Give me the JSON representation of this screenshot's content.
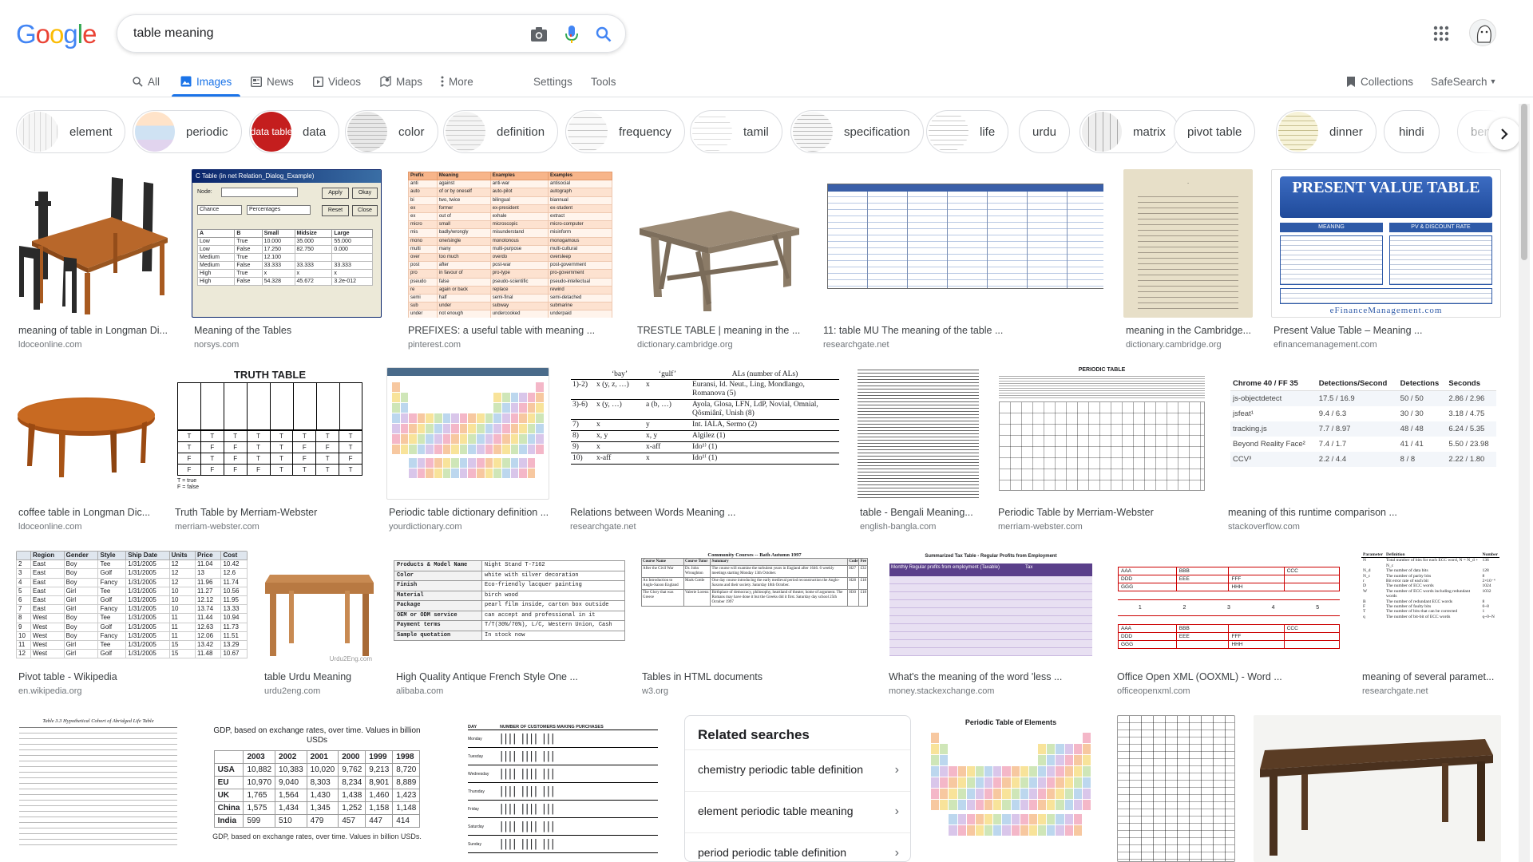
{
  "logo": "Google",
  "search": {
    "query": "table meaning"
  },
  "tabs": [
    {
      "label": "All"
    },
    {
      "label": "Images"
    },
    {
      "label": "News"
    },
    {
      "label": "Videos"
    },
    {
      "label": "Maps"
    },
    {
      "label": "More"
    },
    {
      "label": "Settings"
    },
    {
      "label": "Tools"
    }
  ],
  "topright": {
    "collections": "Collections",
    "safesearch": "SafeSearch"
  },
  "chips": [
    {
      "label": "element"
    },
    {
      "label": "periodic"
    },
    {
      "label": "data",
      "thumb_text": "data table"
    },
    {
      "label": "color"
    },
    {
      "label": "definition"
    },
    {
      "label": "frequency"
    },
    {
      "label": "tamil"
    },
    {
      "label": "specification"
    },
    {
      "label": "life"
    },
    {
      "label": "urdu"
    },
    {
      "label": "matrix"
    },
    {
      "label": "pivot table"
    },
    {
      "label": "dinner"
    },
    {
      "label": "hindi"
    },
    {
      "label": "beng"
    }
  ],
  "results": [
    {
      "title": "meaning of table in Longman Di...",
      "source": "ldoceonline.com"
    },
    {
      "title": "Meaning of the Tables",
      "source": "norsys.com"
    },
    {
      "title": "PREFIXES: a useful table with meaning ...",
      "source": "pinterest.com"
    },
    {
      "title": "TRESTLE TABLE | meaning in the ...",
      "source": "dictionary.cambridge.org"
    },
    {
      "title": "11: table MU The meaning of the table ...",
      "source": "researchgate.net"
    },
    {
      "title": "meaning in the Cambridge...",
      "source": "dictionary.cambridge.org"
    },
    {
      "title": "Present Value Table – Meaning ...",
      "source": "efinancemanagement.com"
    },
    {
      "title": "coffee table in Longman Dic...",
      "source": "ldoceonline.com"
    },
    {
      "title": "Truth Table by Merriam-Webster",
      "source": "merriam-webster.com"
    },
    {
      "title": "Periodic table dictionary definition ...",
      "source": "yourdictionary.com"
    },
    {
      "title": "Relations between Words Meaning ...",
      "source": "researchgate.net"
    },
    {
      "title": "table - Bengali Meaning...",
      "source": "english-bangla.com"
    },
    {
      "title": "Periodic Table by Merriam-Webster",
      "source": "merriam-webster.com"
    },
    {
      "title": "meaning of this runtime comparison ...",
      "source": "stackoverflow.com"
    },
    {
      "title": "Pivot table - Wikipedia",
      "source": "en.wikipedia.org"
    },
    {
      "title": "table Urdu Meaning",
      "source": "urdu2eng.com"
    },
    {
      "title": "High Quality Antique French Style One ...",
      "source": "alibaba.com"
    },
    {
      "title": "Tables in HTML documents",
      "source": "w3.org"
    },
    {
      "title": "What's the meaning of the word 'less ...",
      "source": "money.stackexchange.com"
    },
    {
      "title": "Office Open XML (OOXML) - Word ...",
      "source": "officeopenxml.com"
    },
    {
      "title": "meaning of several paramet...",
      "source": "researchgate.net"
    }
  ],
  "thumbs": {
    "norsys": {
      "title": "C Table (in net Relation_Dialog_Example)",
      "apply": "Apply",
      "okay": "Okay",
      "reset": "Reset",
      "close": "Close",
      "node": "Node:",
      "chance": "Chance",
      "percentages": "Percentages",
      "cols": [
        "A",
        "B",
        "Small",
        "Midsize",
        "Large"
      ],
      "rows": [
        [
          "Low",
          "True",
          "10.000",
          "35.000",
          "55.000"
        ],
        [
          "Low",
          "False",
          "17.250",
          "82.750",
          "0.000"
        ],
        [
          "Medium",
          "True",
          "12.100",
          "",
          ""
        ],
        [
          "Medium",
          "False",
          "33.333",
          "33.333",
          "33.333"
        ],
        [
          "High",
          "True",
          "x",
          "x",
          "x"
        ],
        [
          "High",
          "False",
          "54.328",
          "45.672",
          "3.2e-012"
        ]
      ]
    },
    "prefix": {
      "cols": [
        "Prefix",
        "Meaning",
        "Examples",
        "Examples"
      ],
      "rows": [
        [
          "anti",
          "against",
          "anti-war",
          "antisocial"
        ],
        [
          "auto",
          "of or by oneself",
          "auto-pilot",
          "autograph"
        ],
        [
          "bi",
          "two, twice",
          "bilingual",
          "biannual"
        ],
        [
          "ex",
          "former",
          "ex-president",
          "ex-student"
        ],
        [
          "ex",
          "out of",
          "exhale",
          "extract"
        ],
        [
          "micro",
          "small",
          "microscopic",
          "micro-computer"
        ],
        [
          "mis",
          "badly/wrongly",
          "misunderstand",
          "misinform"
        ],
        [
          "mono",
          "one/single",
          "monotonous",
          "monogamous"
        ],
        [
          "multi",
          "many",
          "multi-purpose",
          "multi-cultural"
        ],
        [
          "over",
          "too much",
          "overdo",
          "oversleep"
        ],
        [
          "post",
          "after",
          "post-war",
          "post-government"
        ],
        [
          "pro",
          "in favour of",
          "pro-type",
          "pro-government"
        ],
        [
          "pseudo",
          "false",
          "pseudo-scientific",
          "pseudo-intellectual"
        ],
        [
          "re",
          "again or back",
          "replace",
          "rewind"
        ],
        [
          "semi",
          "half",
          "semi-final",
          "semi-detached"
        ],
        [
          "sub",
          "under",
          "subway",
          "submarine"
        ],
        [
          "under",
          "not enough",
          "undercooked",
          "underpaid"
        ]
      ]
    },
    "pv": {
      "title": "PRESENT VALUE TABLE",
      "tab1": "MEANING",
      "tab2": "PV & DISCOUNT RATE",
      "brand": "eFinanceManagement.com"
    },
    "truth": {
      "title": "TRUTH TABLE",
      "rows": [
        [
          "T",
          "T",
          "T",
          "T",
          "T",
          "T",
          "T",
          "T"
        ],
        [
          "T",
          "F",
          "F",
          "T",
          "T",
          "F",
          "F",
          "T"
        ],
        [
          "F",
          "T",
          "F",
          "T",
          "T",
          "F",
          "T",
          "F"
        ],
        [
          "F",
          "F",
          "F",
          "F",
          "T",
          "T",
          "T",
          "T"
        ]
      ],
      "legend1": "T = true",
      "legend2": "F = false"
    },
    "relations": {
      "h1": "‘bay’",
      "h2": "‘gulf’",
      "h3": "ALs (number of ALs)",
      "rows": [
        [
          "1)-2)",
          "x (y, z, …)",
          "x",
          "Euransi, Id. Neut., Ling, Mondlango, Romanova (5)"
        ],
        [
          "3)-6)",
          "x (y, …)",
          "a (b, …)",
          "Ayola, Glosa, LFN, LdP, Novial, Omnial, Qôsmiânî, Unish (8)"
        ],
        [
          "7)",
          "x",
          "y",
          "Int. IALA, Sermo (2)"
        ],
        [
          "8)",
          "x, y",
          "x, y",
          "Algilez (1)"
        ],
        [
          "9)",
          "x",
          "x-aff",
          "Ido¹⁾ (1)"
        ],
        [
          "10)",
          "x-aff",
          "x",
          "Ido¹⁽ (1)"
        ]
      ]
    },
    "periodic_title": "PERIODIC TABLE",
    "runtime": {
      "cols": [
        "Chrome 40 / FF 35",
        "Detections/Second",
        "Detections",
        "Seconds"
      ],
      "rows": [
        [
          "js-objectdetect",
          "17.5 / 16.9",
          "50 / 50",
          "2.86 / 2.96"
        ],
        [
          "jsfeat¹",
          "9.4 / 6.3",
          "30 / 30",
          "3.18 / 4.75"
        ],
        [
          "tracking.js",
          "7.7 / 8.97",
          "48 / 48",
          "6.24 / 5.35"
        ],
        [
          "Beyond Reality Face²",
          "7.4 / 1.7",
          "41 / 41",
          "5.50 / 23.98"
        ],
        [
          "CCV³",
          "2.2 / 4.4",
          "8 / 8",
          "2.22 / 1.80"
        ]
      ]
    },
    "pivot": {
      "cols": [
        "",
        "Region",
        "Gender",
        "Style",
        "Ship Date",
        "Units",
        "Price",
        "Cost"
      ],
      "rows": [
        [
          "2",
          "East",
          "Boy",
          "Tee",
          "1/31/2005",
          "12",
          "11.04",
          "10.42"
        ],
        [
          "3",
          "East",
          "Boy",
          "Golf",
          "1/31/2005",
          "12",
          "13",
          "12.6"
        ],
        [
          "4",
          "East",
          "Boy",
          "Fancy",
          "1/31/2005",
          "12",
          "11.96",
          "11.74"
        ],
        [
          "5",
          "East",
          "Girl",
          "Tee",
          "1/31/2005",
          "10",
          "11.27",
          "10.56"
        ],
        [
          "6",
          "East",
          "Girl",
          "Golf",
          "1/31/2005",
          "10",
          "12.12",
          "11.95"
        ],
        [
          "7",
          "East",
          "Girl",
          "Fancy",
          "1/31/2005",
          "10",
          "13.74",
          "13.33"
        ],
        [
          "8",
          "West",
          "Boy",
          "Tee",
          "1/31/2005",
          "11",
          "11.44",
          "10.94"
        ],
        [
          "9",
          "West",
          "Boy",
          "Golf",
          "1/31/2005",
          "11",
          "12.63",
          "11.73"
        ],
        [
          "10",
          "West",
          "Boy",
          "Fancy",
          "1/31/2005",
          "11",
          "12.06",
          "11.51"
        ],
        [
          "11",
          "West",
          "Girl",
          "Tee",
          "1/31/2005",
          "15",
          "13.42",
          "13.29"
        ],
        [
          "12",
          "West",
          "Girl",
          "Golf",
          "1/31/2005",
          "15",
          "11.48",
          "10.67"
        ]
      ]
    },
    "urdu_watermark": "Urdu2Eng.com",
    "product": {
      "rows": [
        [
          "Products & Model Name",
          "Night Stand T-7162"
        ],
        [
          "Color",
          "white with silver decoration"
        ],
        [
          "Finish",
          "Eco-friendly lacquer painting"
        ],
        [
          "Material",
          "birch wood"
        ],
        [
          "Package",
          "pearl film inside, carton box outside"
        ],
        [
          "OEM or ODM service",
          "can accept and professional in it"
        ],
        [
          "Payment terms",
          "T/T(30%/70%), L/C, Western Union, Cash"
        ],
        [
          "Sample quotation",
          "In stock now"
        ]
      ]
    },
    "w3": {
      "title": "Community Courses -- Bath Autumn 1997",
      "cols": [
        "Course Name",
        "Course Tutor",
        "Summary",
        "Code",
        "Fee"
      ],
      "rows": [
        [
          "After the Civil War",
          "Dr. John Wroughton",
          "The course will examine the turbulent years in England after 1646. 6 weekly meetings starting Monday 13th October.",
          "H27",
          "£32"
        ],
        [
          "An Introduction to Anglo-Saxon England",
          "Mark Cottle",
          "One day course introducing the early medieval period reconstruction the Anglo-Saxons and their society. Saturday 18th October.",
          "H28",
          "£18"
        ],
        [
          "The Glory that was Greece",
          "Valerie Lorenz",
          "Birthplace of democracy, philosophy, heartland of theater, home of argument. The Romans may have done it but the Greeks did it first. Saturday day school 25th October 1997",
          "H30",
          "£18"
        ]
      ]
    },
    "tax": {
      "title": "Summarized Tax Table - Regular Profits from Employment",
      "h1": "Monthly Regular profits from employment (Taxable)",
      "h2": "Tax"
    },
    "ooxml": {
      "r1": [
        "AAA",
        "BBB",
        "",
        "CCC"
      ],
      "r2": [
        "DDD",
        "EEE",
        "FFF",
        ""
      ],
      "r3": [
        "GGG",
        "",
        "HHH",
        ""
      ],
      "nums": [
        "1",
        "2",
        "3",
        "4",
        "5"
      ]
    },
    "params": {
      "cols": [
        "Parameter",
        "Definition",
        "Number"
      ],
      "rows": [
        [
          "N",
          "Total number of bits for each ECC word, N = N_d + N_c",
          "136"
        ],
        [
          "N_d",
          "The number of data bits",
          "128"
        ],
        [
          "N_c",
          "The number of parity bits",
          "8"
        ],
        [
          "r",
          "Bit error rate of each bit",
          "2×10⁻⁴"
        ],
        [
          "D",
          "The number of ECC words",
          "1024"
        ],
        [
          "W",
          "The number of ECC words including redundant words",
          "1032"
        ],
        [
          "B",
          "The number of redundant ECC words",
          "8"
        ],
        [
          "F",
          "The number of faulty bits",
          "0~8"
        ],
        [
          "T",
          "The number of bits that can be corrected",
          "1"
        ],
        [
          "q",
          "The number of bit-bit of ECC words",
          "q~0~N"
        ]
      ]
    },
    "life": {
      "title": "Table 3.3 Hypothetical Cohort of Abridged Life Table"
    },
    "gdp": {
      "title": "GDP, based on exchange rates, over time. Values in billion USDs",
      "years": [
        "2003",
        "2002",
        "2001",
        "2000",
        "1999",
        "1998"
      ],
      "rows": [
        [
          "USA",
          "10,882",
          "10,383",
          "10,020",
          "9,762",
          "9,213",
          "8,720"
        ],
        [
          "EU",
          "10,970",
          "9,040",
          "8,303",
          "8,234",
          "8,901",
          "8,889"
        ],
        [
          "UK",
          "1,765",
          "1,564",
          "1,430",
          "1,438",
          "1,460",
          "1,423"
        ],
        [
          "China",
          "1,575",
          "1,434",
          "1,345",
          "1,252",
          "1,158",
          "1,148"
        ],
        [
          "India",
          "599",
          "510",
          "479",
          "457",
          "447",
          "414"
        ]
      ],
      "caption": "GDP, based on exchange rates, over time. Values in billion USDs."
    },
    "tally": {
      "h1": "DAY",
      "h2": "NUMBER OF CUSTOMERS MAKING PURCHASES",
      "days": [
        "Monday",
        "Tuesday",
        "Wednesday",
        "Thursday",
        "Friday",
        "Saturday",
        "Sunday"
      ]
    },
    "periodic2_title": "Periodic Table of Elements"
  },
  "related": {
    "heading": "Related searches",
    "items": [
      {
        "label": "chemistry periodic table definition"
      },
      {
        "label": "element periodic table meaning"
      },
      {
        "label": "period periodic table definition"
      }
    ]
  },
  "colors": {
    "accent": "#1a73e8",
    "wood": "#a85a20",
    "pv_blue": "#2e5aa8",
    "tax_purple": "#5a3f8a"
  }
}
